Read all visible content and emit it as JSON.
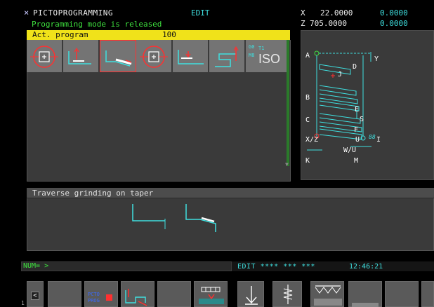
{
  "header": {
    "close_glyph": "×",
    "title": "PICTOPROGRAMMING",
    "mode": "EDIT",
    "status_message": "Programming mode is released"
  },
  "coordinates": {
    "x_label": "X",
    "x_value": "22.0000",
    "x_offset": "0.0000",
    "z_label": "Z",
    "z_value": "705.0000",
    "z_offset": "0.0000"
  },
  "program_bar": {
    "label": "Act. program",
    "number": "100"
  },
  "tool_icons": [
    {
      "name": "tool-circle-target-icon",
      "selected": false
    },
    {
      "name": "tool-plunge-step-icon",
      "selected": false
    },
    {
      "name": "tool-taper-grind-icon",
      "selected": true
    },
    {
      "name": "tool-circle-target-icon-2",
      "selected": false
    },
    {
      "name": "tool-shoulder-icon",
      "selected": false
    },
    {
      "name": "tool-step-profile-icon",
      "selected": false
    },
    {
      "name": "tool-iso-icon",
      "selected": false
    }
  ],
  "iso_icon": {
    "line1": "G0",
    "line1b": "T1",
    "line2": "M8",
    "main": "ISO"
  },
  "preview": {
    "labels": {
      "A": "A",
      "B": "B",
      "C": "C",
      "D": "D",
      "E": "E",
      "F": "F",
      "J": "J",
      "Y": "Y",
      "S": "S",
      "I": "I",
      "U": "U",
      "XZ": "X/Z",
      "WU": "W/U",
      "K": "K",
      "M": "M"
    }
  },
  "description": {
    "title": "Traverse grinding on taper"
  },
  "status": {
    "num_label": "NUM= >",
    "edit_text": "EDIT **** *** ***",
    "clock": "12:46:21"
  },
  "softkeys": {
    "back_glyph": "<",
    "pcto_label_1": "PCTO",
    "pcto_label_2": "PROG",
    "page_number": "1"
  },
  "colors": {
    "accent_cyan": "#3fe0e0",
    "accent_green": "#3ee03e",
    "program_bar": "#f0e21a",
    "selection_red": "#ff3030"
  }
}
